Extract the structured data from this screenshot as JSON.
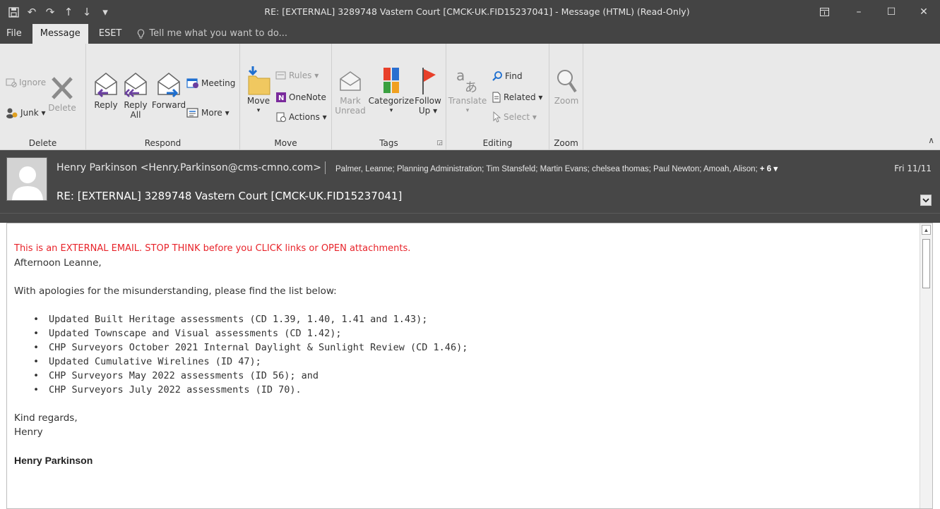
{
  "window": {
    "title": "RE: [EXTERNAL] 3289748 Vastern Court [CMCK-UK.FID15237041] - Message (HTML) (Read-Only)",
    "controls": {
      "ribbon_display": "⊞",
      "minimize": "–",
      "maximize": "☐",
      "close": "✕"
    }
  },
  "qat": {
    "save": "🖫",
    "undo": "↶",
    "redo": "↷",
    "up": "↑",
    "down": "↓",
    "customize": "▾"
  },
  "tabs": [
    {
      "label": "File"
    },
    {
      "label": "Message"
    },
    {
      "label": "ESET"
    }
  ],
  "tell_me": {
    "placeholder": "Tell me what you want to do..."
  },
  "ribbon": {
    "delete": {
      "label": "Delete",
      "ignore": "Ignore",
      "junk": "Junk ▾",
      "delete_btn": "Delete"
    },
    "respond": {
      "label": "Respond",
      "reply": "Reply",
      "reply_all_1": "Reply",
      "reply_all_2": "All",
      "forward": "Forward",
      "meeting": "Meeting",
      "more": "More ▾"
    },
    "move": {
      "label": "Move",
      "move_btn": "Move",
      "move_arrow": "▾",
      "rules": "Rules ▾",
      "onenote": "OneNote",
      "actions": "Actions ▾"
    },
    "tags": {
      "label": "Tags",
      "mark_unread_1": "Mark",
      "mark_unread_2": "Unread",
      "categorize_1": "Categorize",
      "categorize_2": "▾",
      "follow_up_1": "Follow",
      "follow_up_2": "Up ▾"
    },
    "editing": {
      "label": "Editing",
      "translate_1": "Translate",
      "translate_2": "▾",
      "find": "Find",
      "related": "Related ▾",
      "select": "Select ▾"
    },
    "zoom": {
      "label": "Zoom",
      "zoom_btn": "Zoom"
    }
  },
  "message": {
    "from": "Henry Parkinson <Henry.Parkinson@cms-cmno.com>",
    "to": "Palmer, Leanne; Planning Administration; Tim Stansfeld; Martin Evans; chelsea thomas; Paul Newton; Amoah, Alison;",
    "more_recipients": "+ 6 ▾",
    "date": "Fri 11/11",
    "subject": "RE: [EXTERNAL] 3289748 Vastern Court [CMCK-UK.FID15237041]"
  },
  "body": {
    "warning": "This is an EXTERNAL EMAIL. STOP THINK before you CLICK links or OPEN attachments.",
    "greeting": "Afternoon Leanne,",
    "intro": "With apologies for the misunderstanding, please find the list below:",
    "items": [
      "Updated Built Heritage assessments (CD 1.39, 1.40, 1.41 and 1.43);",
      "Updated Townscape and Visual assessments (CD 1.42);",
      "CHP Surveyors October 2021 Internal Daylight & Sunlight Review (CD 1.46);",
      "Updated Cumulative Wirelines (ID 47);",
      "CHP Surveyors May 2022 assessments (ID 56); and",
      "CHP Surveyors July 2022 assessments (ID 70)."
    ],
    "closing": "Kind regards,",
    "signoff": "Henry",
    "signature_name": "Henry Parkinson"
  },
  "colors": {
    "titlebar": "#444444",
    "ribbon": "#e9e9e9",
    "header": "#474747",
    "warning": "#e8232a",
    "accent_blue": "#1e6fd0",
    "flag_red": "#e8402a"
  }
}
